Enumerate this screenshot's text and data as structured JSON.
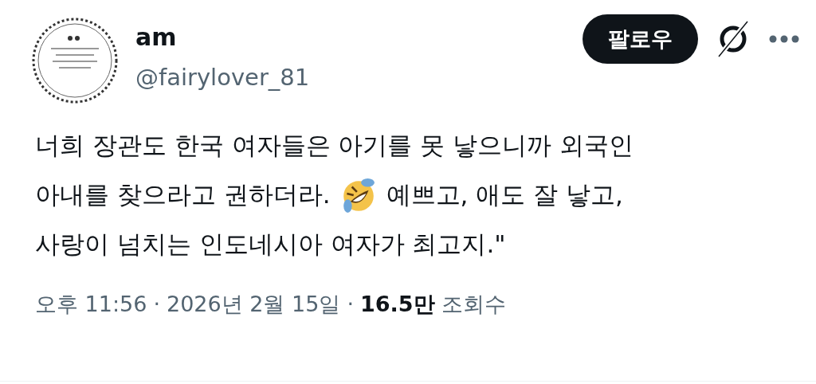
{
  "author": {
    "name": "am",
    "handle": "@fairylover_81"
  },
  "actions": {
    "follow": "팔로우"
  },
  "body": [
    [
      {
        "kind": "text",
        "text": "너희 장관도 한국 여자들은 아기를 못 낳으니까 외국인"
      }
    ],
    [
      {
        "kind": "text",
        "text": "아내를 찾으라고 권하더라."
      },
      {
        "kind": "emoji"
      },
      {
        "kind": "text",
        "text": "예쁘고, 애도 잘 낳고,"
      }
    ],
    [
      {
        "kind": "text",
        "text": "사랑이 넘치는 인도네시아 여자가 최고지.\""
      }
    ]
  ],
  "meta": {
    "time": "오후 11:56",
    "separator": "·",
    "date": "2026년 2월 15일",
    "separator_2": "·",
    "views": "16.5만",
    "views_label": "조회수"
  }
}
